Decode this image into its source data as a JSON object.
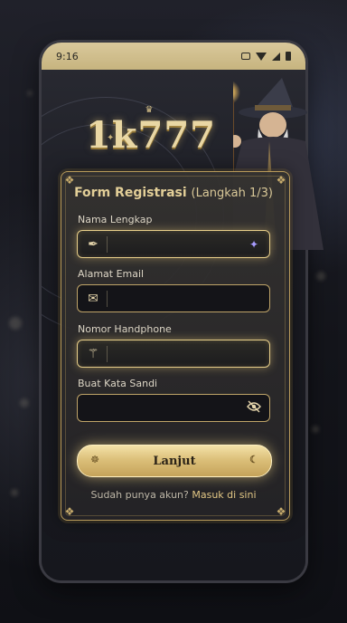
{
  "status_bar": {
    "time": "9:16"
  },
  "brand": {
    "logo_text": "1k777"
  },
  "form": {
    "title": "Form Registrasi",
    "step_text": "(Langkah 1/3)",
    "fields": [
      {
        "label": "Nama Lengkap",
        "placeholder": "",
        "value": "",
        "icon": "feather-quill-icon",
        "right_icon": "sparkle-icon"
      },
      {
        "label": "Alamat Email",
        "placeholder": "",
        "value": "",
        "icon": "envelope-icon"
      },
      {
        "label": "Nomor Handphone",
        "placeholder": "",
        "value": "",
        "icon": "magic-wand-icon"
      },
      {
        "label": "Buat Kata Sandi",
        "placeholder": "",
        "value": "",
        "right_icon": "eye-off-icon"
      }
    ],
    "submit_label": "Lanjut",
    "signin_prompt": "Sudah punya akun?",
    "signin_link": "Masuk di sini"
  },
  "colors": {
    "accent_gold": "#e3cf98",
    "button_gold": "#dcc07a",
    "status_bar": "#d9c89b"
  }
}
